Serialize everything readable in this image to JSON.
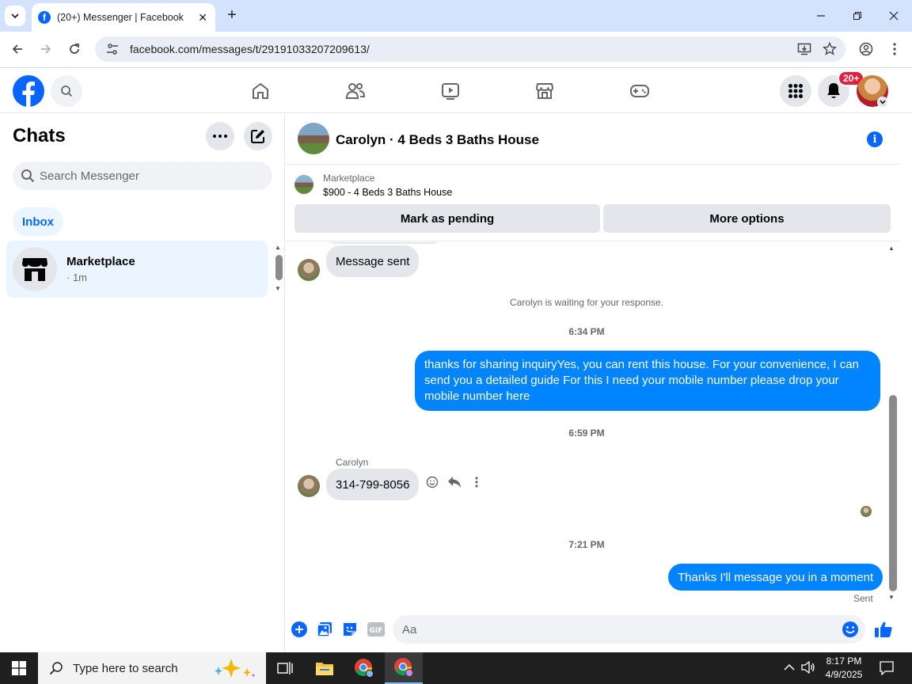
{
  "browser": {
    "tab_title": "(20+) Messenger | Facebook",
    "url": "facebook.com/messages/t/29191033207209613/"
  },
  "fb_header": {
    "notification_badge": "20+"
  },
  "sidebar": {
    "title": "Chats",
    "search_placeholder": "Search Messenger",
    "filter_pill": "Inbox",
    "chats": [
      {
        "name": "Marketplace",
        "time": "· 1m"
      }
    ]
  },
  "conversation": {
    "title": "Carolyn · 4 Beds 3 Baths House",
    "marketplace": {
      "label": "Marketplace",
      "listing": "$900 - 4 Beds 3 Baths House",
      "pending_button": "Mark as pending",
      "options_button": "More options"
    },
    "messages": {
      "first_in": "Message sent",
      "waiting_notice": "Carolyn is waiting for your response.",
      "time1": "6:34 PM",
      "out1": "thanks for sharing inquiryYes, you can rent this house. For your convenience, I can send you a detailed guide For this I need your mobile number please drop your mobile number here",
      "time2": "6:59 PM",
      "sender": "Carolyn",
      "in2": "314-799-8056",
      "time3": "7:21 PM",
      "out2": "Thanks I'll message you in a moment",
      "status": "Sent"
    },
    "composer_placeholder": "Aa"
  },
  "taskbar": {
    "search_placeholder": "Type here to search",
    "time": "8:17 PM",
    "date": "4/9/2025"
  },
  "colors": {
    "accent": "#0866ff",
    "outgoing_bubble": "#0084ff",
    "incoming_bubble": "#e4e6eb"
  }
}
